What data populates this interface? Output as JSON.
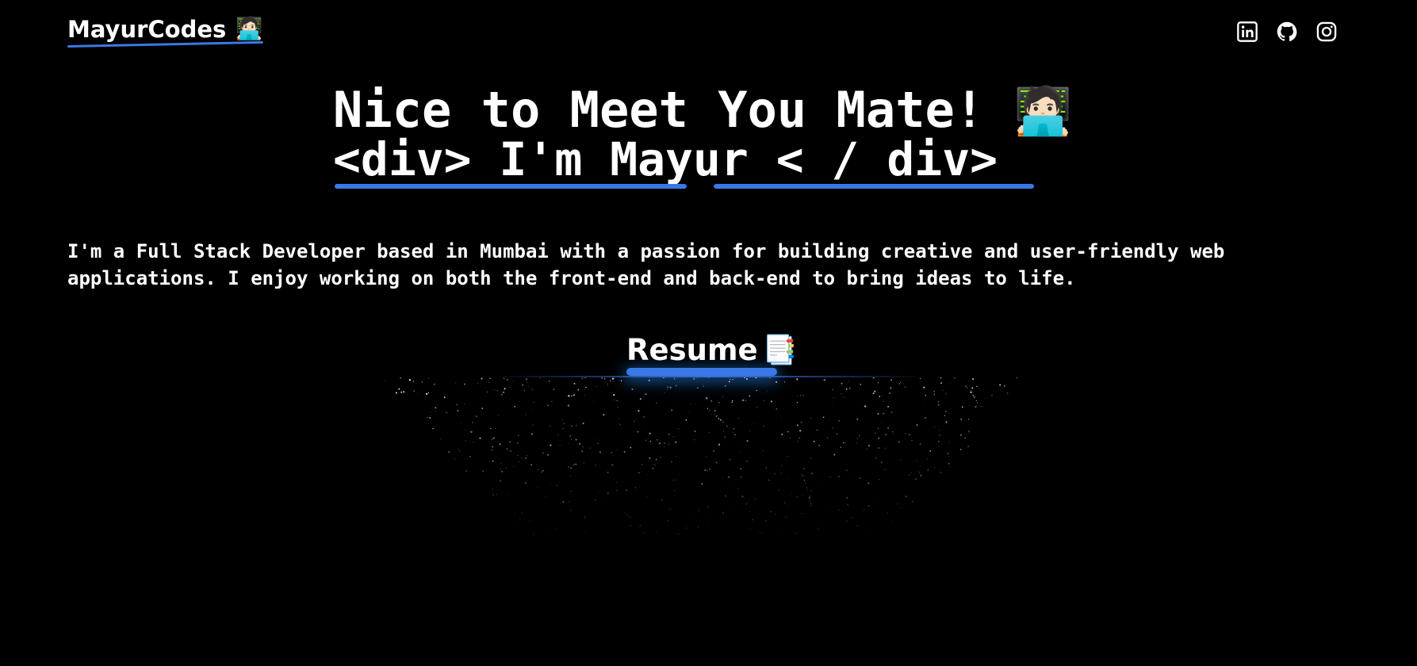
{
  "header": {
    "logo_text": "MayurCodes",
    "logo_emoji": "🧑🏻‍💻",
    "social": [
      {
        "name": "linkedin-icon",
        "label": "LinkedIn"
      },
      {
        "name": "github-icon",
        "label": "GitHub"
      },
      {
        "name": "instagram-icon",
        "label": "Instagram"
      }
    ]
  },
  "hero": {
    "title": "Nice to Meet You Mate!",
    "title_emoji": "🧑🏻‍💻",
    "subtitle": "<div> I'm Mayur < / div>"
  },
  "intro": {
    "text": "I'm a Full Stack Developer based in Mumbai with a passion for building creative and user-friendly web applications. I enjoy working on both the front-end and back-end to bring ideas to life."
  },
  "resume": {
    "label": "Resume",
    "emoji": "📑"
  },
  "colors": {
    "background": "#000000",
    "text": "#ffffff",
    "accent": "#3b78e7"
  }
}
